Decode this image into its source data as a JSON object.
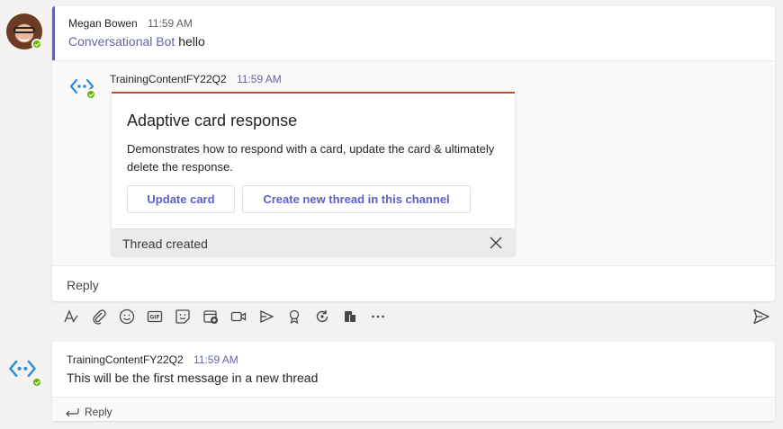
{
  "root_message": {
    "author": "Megan Bowen",
    "time": "11:59 AM",
    "mention": "Conversational Bot",
    "text": "hello"
  },
  "bot_reply": {
    "author": "TrainingContentFY22Q2",
    "time": "11:59 AM",
    "card": {
      "title": "Adaptive card response",
      "description": "Demonstrates how to respond with a card, update the card & ultimately delete the response.",
      "buttons": [
        {
          "label": "Update card"
        },
        {
          "label": "Create new thread in this channel"
        }
      ],
      "status": "Thread created"
    }
  },
  "compose": {
    "reply_placeholder": "Reply",
    "toolbar_icons": [
      "format-icon",
      "attach-icon",
      "emoji-icon",
      "gif-icon",
      "sticker-icon",
      "schedule-meeting-icon",
      "video-icon",
      "stream-icon",
      "praise-icon",
      "loop-icon",
      "apps-icon",
      "more-icon"
    ]
  },
  "new_thread_message": {
    "author": "TrainingContentFY22Q2",
    "time": "11:59 AM",
    "text": "This will be the first message in a new thread",
    "reply_label": "Reply"
  },
  "colors": {
    "accent": "#6264a7",
    "card_top_border": "#c4502c",
    "presence_available": "#6bb700",
    "bot_icon": "#2f8ed9"
  }
}
